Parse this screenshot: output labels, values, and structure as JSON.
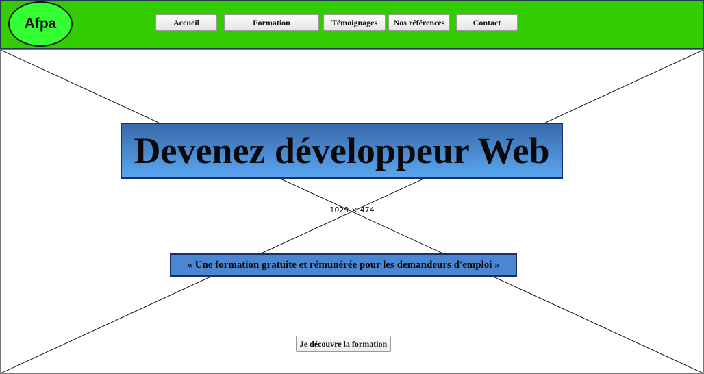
{
  "header": {
    "logo_text": "Afpa",
    "nav": [
      {
        "label": "Accueil"
      },
      {
        "label": "Formation"
      },
      {
        "label": "Témoignages"
      },
      {
        "label": "Nos références"
      },
      {
        "label": "Contact"
      }
    ],
    "background_color": "#33cc00"
  },
  "hero": {
    "placeholder_size": "1029 × 474",
    "title": "Devenez développeur Web",
    "subtitle": "« Une formation gratuite et rémunérée pour les demandeurs d'emploi »",
    "cta_label": "Je découvre la formation"
  }
}
